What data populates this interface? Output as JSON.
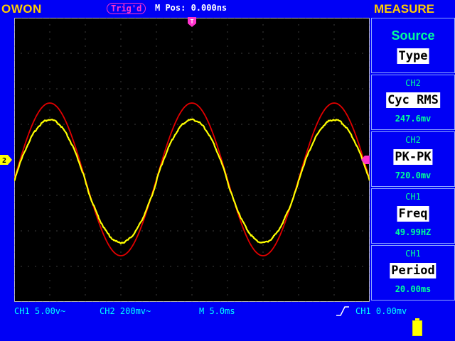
{
  "header": {
    "brand": "OWON",
    "trigger_status": "Trig'd",
    "m_pos": "M Pos: 0.000ns",
    "menu_title": "MEASURE"
  },
  "markers": {
    "ch2_marker": "2",
    "trigger_pos_marker": "T",
    "trigger_level_marker": "◄"
  },
  "measure_panel": {
    "source_title": "Source",
    "type_label": "Type",
    "items": [
      {
        "channel": "CH2",
        "name": "Cyc RMS",
        "value": "247.6mv"
      },
      {
        "channel": "CH2",
        "name": "PK-PK",
        "value": "720.0mv"
      },
      {
        "channel": "CH1",
        "name": "Freq",
        "value": "49.99HZ"
      },
      {
        "channel": "CH1",
        "name": "Period",
        "value": "20.00ms"
      }
    ]
  },
  "status_bar": {
    "ch1": "CH1 5.00v~",
    "ch2": "CH2 200mv~",
    "timebase": "M 5.0ms",
    "trigger": "CH1 0.00mv"
  },
  "colors": {
    "background": "#0000f5",
    "screen": "#000000",
    "ch1_trace": "#ffff00",
    "ch2_trace": "#e00000",
    "brand": "#ffcc00",
    "trigger": "#ff33cc",
    "measure_text": "#00ff99",
    "status_text": "#00ffff"
  },
  "icons": {
    "trigger_edge": "rising-edge-icon",
    "battery": "battery-icon"
  },
  "chart_data": {
    "type": "line",
    "series": [
      {
        "name": "CH1",
        "color": "#ffff00",
        "frequency_hz": 49.99,
        "period_ms": 20.0,
        "offset_divisions": -0.6,
        "amplitude_divisions": 1.73
      },
      {
        "name": "CH2",
        "color": "#e00000",
        "frequency_hz": 49.99,
        "period_ms": 20.0,
        "offset_divisions": -0.55,
        "amplitude_divisions": 2.15
      }
    ],
    "time_per_division_ms": 5.0,
    "horizontal_divisions": 10,
    "vertical_divisions": 8,
    "grid": true
  }
}
